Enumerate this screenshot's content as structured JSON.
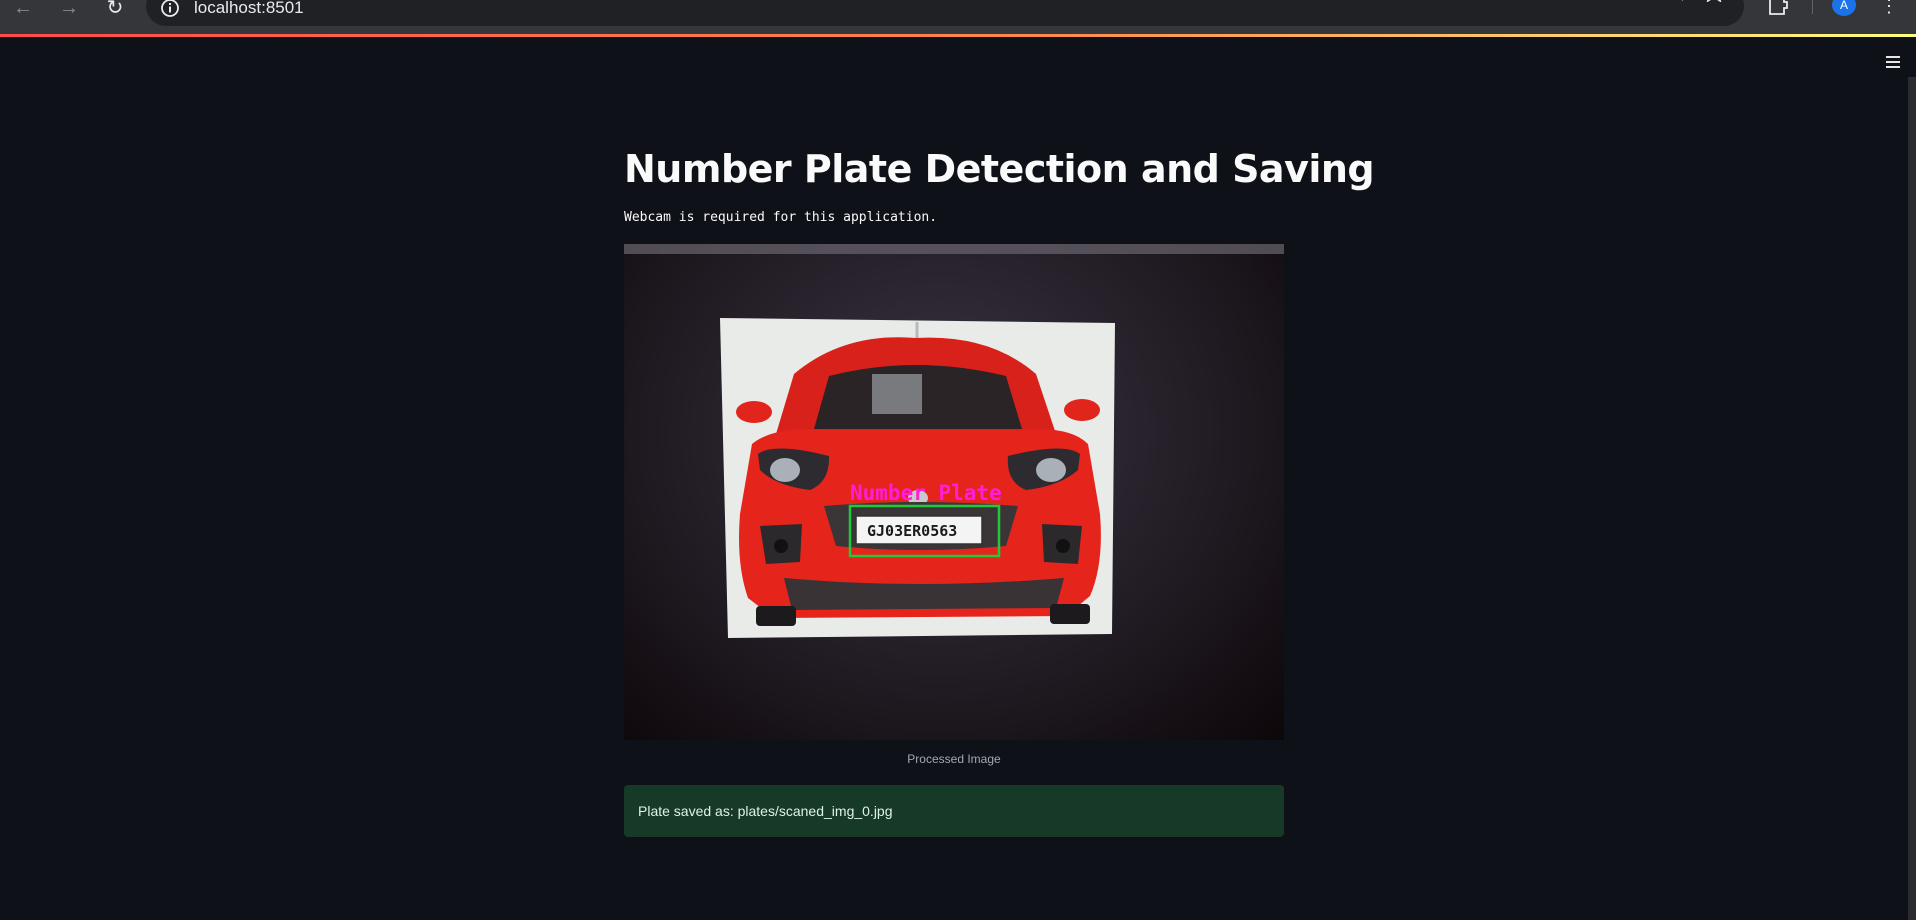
{
  "browser": {
    "url": "localhost:8501",
    "profile_initial": "A",
    "icons": {
      "back": "back-arrow-icon",
      "forward": "forward-arrow-icon",
      "reload": "reload-icon",
      "site_info": "info-icon",
      "zoom": "zoom-out-icon",
      "bookmark": "star-icon",
      "extensions": "puzzle-icon",
      "menu": "more-vert-icon"
    }
  },
  "app": {
    "title": "Number Plate Detection and Saving",
    "note": "Webcam is required for this application.",
    "image": {
      "detection_label": "Number Plate",
      "plate_text": "GJ03ER0563",
      "caption": "Processed Image"
    },
    "status": {
      "message": "Plate saved as: plates/scaned_img_0.jpg"
    }
  },
  "colors": {
    "background": "#0e1117",
    "text": "#fafafa",
    "success_bg": "#173928",
    "detection_box": "#21c93a",
    "detection_label": "#ff1dd8",
    "car_body": "#e5241c"
  }
}
